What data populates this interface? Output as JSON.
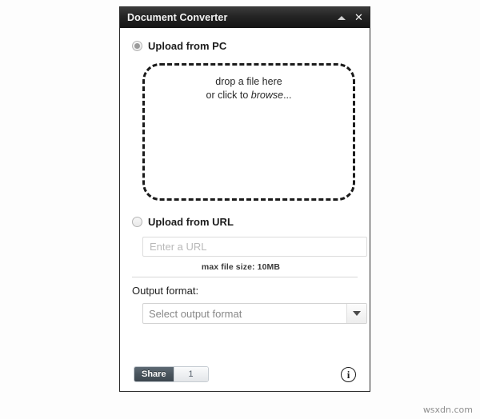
{
  "window": {
    "title": "Document Converter",
    "controls": [
      {
        "name": "collapse",
        "icon": "chevron-up-icon"
      },
      {
        "name": "close",
        "icon": "close-icon"
      }
    ]
  },
  "upload_pc": {
    "label": "Upload from PC",
    "selected": true,
    "dropzone": {
      "line1": "drop a file here",
      "line2_prefix": "or click to ",
      "line2_emphasis": "browse",
      "line2_suffix": "..."
    }
  },
  "upload_url": {
    "label": "Upload from URL",
    "selected": false,
    "input_value": "",
    "input_placeholder": "Enter a URL"
  },
  "limits": {
    "max_file_size": "max file size: 10MB"
  },
  "output": {
    "label": "Output format:",
    "selected_value": "Select output format",
    "dropdown_icon": "chevron-down-icon"
  },
  "footer": {
    "share_label": "Share",
    "share_count": "1",
    "info_icon": "info-icon",
    "info_glyph": "i"
  },
  "watermark": "wsxdn.com",
  "colors": {
    "titlebar": "#242424",
    "share_button": "#49545d",
    "dropzone_border": "#1b1b1b"
  }
}
